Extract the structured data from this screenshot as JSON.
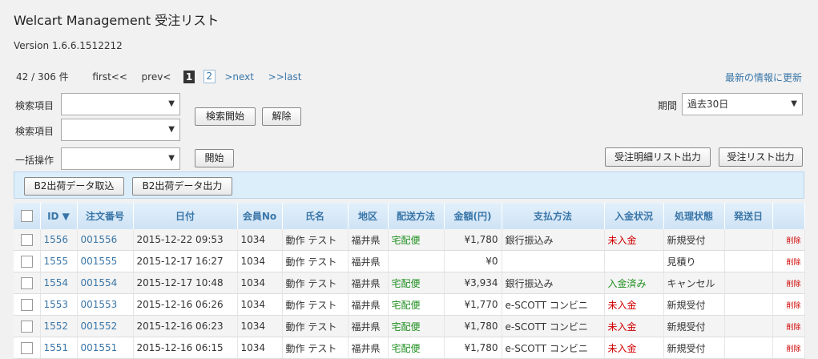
{
  "header": {
    "title": "Welcart Management 受注リスト",
    "version": "Version 1.6.6.1512212"
  },
  "pager": {
    "count": "42 / 306 件",
    "first": "first<<",
    "prev": "prev<",
    "current": "1",
    "page2": "2",
    "next": ">next",
    "last": ">>last",
    "refresh": "最新の情報に更新"
  },
  "search": {
    "label1": "検索項目",
    "label2": "検索項目",
    "select1_value": "",
    "select2_value": "",
    "search_button": "検索開始",
    "reset_button": "解除"
  },
  "bulk": {
    "label": "一括操作",
    "select_value": "",
    "start_button": "開始"
  },
  "period": {
    "label": "期間",
    "value": "過去30日"
  },
  "export": {
    "detail_button": "受注明細リスト出力",
    "list_button": "受注リスト出力"
  },
  "b2": {
    "import_button": "B2出荷データ取込",
    "export_button": "B2出荷データ出力"
  },
  "table": {
    "headers": [
      "",
      "ID ▼",
      "注文番号",
      "日付",
      "会員No",
      "氏名",
      "地区",
      "配送方法",
      "金額(円)",
      "支払方法",
      "入金状況",
      "処理状態",
      "発送日",
      ""
    ],
    "rows": [
      {
        "id": "1556",
        "order": "001556",
        "date": "2015-12-22 09:53",
        "member": "1034",
        "name": "動作 テスト",
        "area": "福井県",
        "delivery": "宅配便",
        "amount": "¥1,780",
        "payment": "銀行振込み",
        "deposit": "未入金",
        "status": "新規受付",
        "ship": "",
        "del": "削除"
      },
      {
        "id": "1555",
        "order": "001555",
        "date": "2015-12-17 16:27",
        "member": "1034",
        "name": "動作 テスト",
        "area": "福井県",
        "delivery": "",
        "amount": "¥0",
        "payment": "",
        "deposit": "",
        "status": "見積り",
        "ship": "",
        "del": "削除"
      },
      {
        "id": "1554",
        "order": "001554",
        "date": "2015-12-17 10:48",
        "member": "1034",
        "name": "動作 テスト",
        "area": "福井県",
        "delivery": "宅配便",
        "amount": "¥3,934",
        "payment": "銀行振込み",
        "deposit": "入金済み",
        "status": "キャンセル",
        "ship": "",
        "del": "削除"
      },
      {
        "id": "1553",
        "order": "001553",
        "date": "2015-12-16 06:26",
        "member": "1034",
        "name": "動作 テスト",
        "area": "福井県",
        "delivery": "宅配便",
        "amount": "¥1,770",
        "payment": "e-SCOTT コンビニ",
        "deposit": "未入金",
        "status": "新規受付",
        "ship": "",
        "del": "削除"
      },
      {
        "id": "1552",
        "order": "001552",
        "date": "2015-12-16 06:23",
        "member": "1034",
        "name": "動作 テスト",
        "area": "福井県",
        "delivery": "宅配便",
        "amount": "¥1,780",
        "payment": "e-SCOTT コンビニ",
        "deposit": "未入金",
        "status": "新規受付",
        "ship": "",
        "del": "削除"
      },
      {
        "id": "1551",
        "order": "001551",
        "date": "2015-12-16 06:15",
        "member": "1034",
        "name": "動作 テスト",
        "area": "福井県",
        "delivery": "宅配便",
        "amount": "¥1,780",
        "payment": "e-SCOTT コンビニ",
        "deposit": "未入金",
        "status": "新規受付",
        "ship": "",
        "del": "削除"
      }
    ]
  },
  "colors": {
    "link": "#3a76a8",
    "green": "#1e8e1e",
    "red": "#d00000",
    "header_bg": "#cfe3f5"
  }
}
